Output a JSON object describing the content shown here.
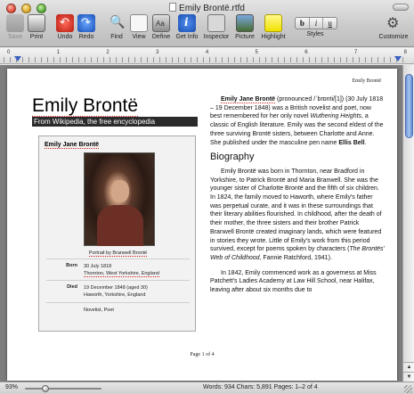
{
  "window": {
    "title": "Emily Brontë.rtfd"
  },
  "toolbar": {
    "save": "Save",
    "print": "Print",
    "undo": "Undo",
    "redo": "Redo",
    "find": "Find",
    "view": "View",
    "define": "Define",
    "get_info": "Get Info",
    "inspector": "Inspector",
    "picture": "Picture",
    "highlight": "Highlight",
    "styles": "Styles",
    "styles_buttons": [
      "b",
      "i",
      "u"
    ],
    "customize": "Customize"
  },
  "ruler": {
    "numbers": [
      "0",
      "1",
      "2",
      "3",
      "4",
      "5",
      "6",
      "7",
      "8"
    ]
  },
  "page": {
    "running_header": "Emily Brontë",
    "title": "Emily Brontë",
    "wiki_subtitle": "From Wikipedia, the free encyclopedia",
    "infobox": {
      "heading": "Emily Jane Brontë",
      "caption": "Portrait by Branwell Brontë",
      "born_label": "Born",
      "born_date": "30 July 1818",
      "born_place": "Thornton, West Yorkshire, England",
      "died_label": "Died",
      "died_date": "19 December 1848 (aged 30)",
      "died_place": "Haworth, Yorkshire, England",
      "occupation": "Novelist, Poet"
    },
    "intro": {
      "name": "Emily Jane Brontë",
      "pron": " (pronounced /ˈbrɒnti/[1]) (30 July 1818 – 19 December 1848) was a British novelist and poet, now best remembered for her only novel ",
      "novel": "Wuthering Heights",
      "rest": ", a classic of English literature. Emily was the second eldest of the three surviving Brontë sisters, between Charlotte and Anne. She published under the masculine pen name ",
      "pen_name": "Ellis Bell",
      "end": "."
    },
    "biography_heading": "Biography",
    "bio_p1a": "Emily Brontë was born in Thornton, near Bradford in Yorkshire, to Patrick Brontë and Maria Branwell. She was the younger sister of Charlotte Brontë and the fifth of six children. In 1824, the family moved to Haworth, where Emily's father was perpetual curate, and it was in these surroundings that their literary abilities flourished. In childhood, after the death of their mother, the three sisters and their brother Patrick Branwell Brontë created imaginary lands, which were featured in stories they wrote. Little of Emily's work from this period survived, except for poems spoken by characters (",
    "bio_p1_italic": "The Brontës' Web of Childhood",
    "bio_p1b": ", Fannie Ratchford, 1941).",
    "bio_p2": "In 1842, Emily commenced work as a governess at Miss Patchett's Ladies Academy at Law Hill School, near Halifax, leaving after about six months due to",
    "footer": "Page 1 of 4"
  },
  "status": {
    "zoom": "93%",
    "zoom_fraction": 0.27,
    "counts": "Words: 934  Chars: 5,891  Pages: 1–2 of 4"
  },
  "colors": {
    "accent": "#3a5fbf",
    "scroll_thumb": "#6a93d8",
    "highlight": "#f0e000"
  }
}
